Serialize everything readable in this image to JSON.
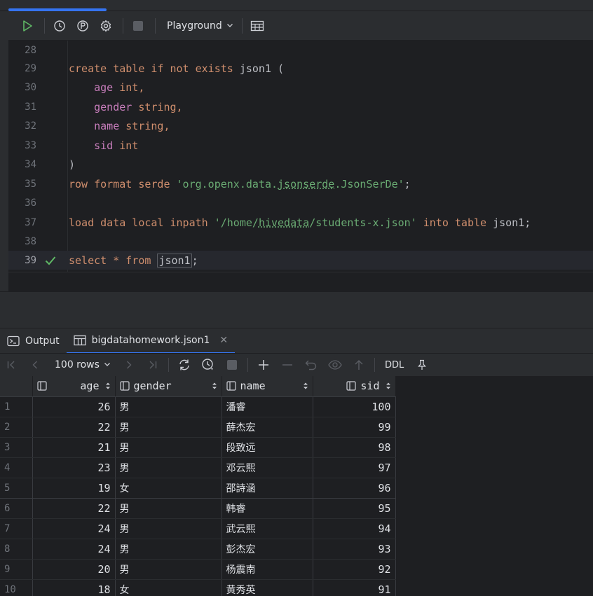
{
  "editor": {
    "toolbar": {
      "session_label": "Playground"
    },
    "lines": [
      {
        "num": "28"
      },
      {
        "num": "29"
      },
      {
        "num": "30"
      },
      {
        "num": "31"
      },
      {
        "num": "32"
      },
      {
        "num": "33"
      },
      {
        "num": "34"
      },
      {
        "num": "35"
      },
      {
        "num": "36"
      },
      {
        "num": "37"
      },
      {
        "num": "38"
      },
      {
        "num": "39"
      }
    ],
    "code": {
      "l29_kw": "create table if not exists",
      "l29_name": "json1 (",
      "l30_col": "age",
      "l30_type": "int,",
      "l31_col": "gender",
      "l31_type": "string,",
      "l32_col": "name",
      "l32_type": "string,",
      "l33_col": "sid",
      "l33_type": "int",
      "l34": ")",
      "l35_kw": "row format serde",
      "l35_str_a": "'org.openx.data.",
      "l35_str_u": "jsonserde",
      "l35_str_b": ".JsonSerDe'",
      "l35_end": ";",
      "l37_kw": "load data local inpath",
      "l37_str_a": "'/home/",
      "l37_str_u": "hivedata",
      "l37_str_b": "/students-x.json'",
      "l37_kw2": "into table",
      "l37_end": "json1;",
      "l39_kw": "select",
      "l39_star": "*",
      "l39_kw2": "from",
      "l39_name": "json1",
      "l39_end": ";"
    }
  },
  "results": {
    "tabs": [
      {
        "label": "Output"
      },
      {
        "label": "bigdatahomework.json1",
        "close": "✕"
      }
    ],
    "toolbar": {
      "rows_label": "100 rows",
      "ddl_label": "DDL"
    },
    "columns": [
      "age",
      "gender",
      "name",
      "sid"
    ],
    "rows": [
      {
        "n": "1",
        "age": "26",
        "gender": "男",
        "name": "潘睿",
        "sid": "100"
      },
      {
        "n": "2",
        "age": "22",
        "gender": "男",
        "name": "薛杰宏",
        "sid": "99"
      },
      {
        "n": "3",
        "age": "21",
        "gender": "男",
        "name": "段致远",
        "sid": "98"
      },
      {
        "n": "4",
        "age": "23",
        "gender": "男",
        "name": "邓云熙",
        "sid": "97"
      },
      {
        "n": "5",
        "age": "19",
        "gender": "女",
        "name": "邵詩涵",
        "sid": "96"
      },
      {
        "n": "6",
        "age": "22",
        "gender": "男",
        "name": "韩睿",
        "sid": "95"
      },
      {
        "n": "7",
        "age": "24",
        "gender": "男",
        "name": "武云熙",
        "sid": "94"
      },
      {
        "n": "8",
        "age": "24",
        "gender": "男",
        "name": "彭杰宏",
        "sid": "93"
      },
      {
        "n": "9",
        "age": "20",
        "gender": "男",
        "name": "杨震南",
        "sid": "92"
      },
      {
        "n": "10",
        "age": "18",
        "gender": "女",
        "name": "黄秀英",
        "sid": "91"
      }
    ]
  },
  "colors": {
    "accent": "#3574f0",
    "run": "#5fb865",
    "keyword": "#cf8e6d",
    "column": "#c77dbb",
    "string": "#6aab73"
  }
}
